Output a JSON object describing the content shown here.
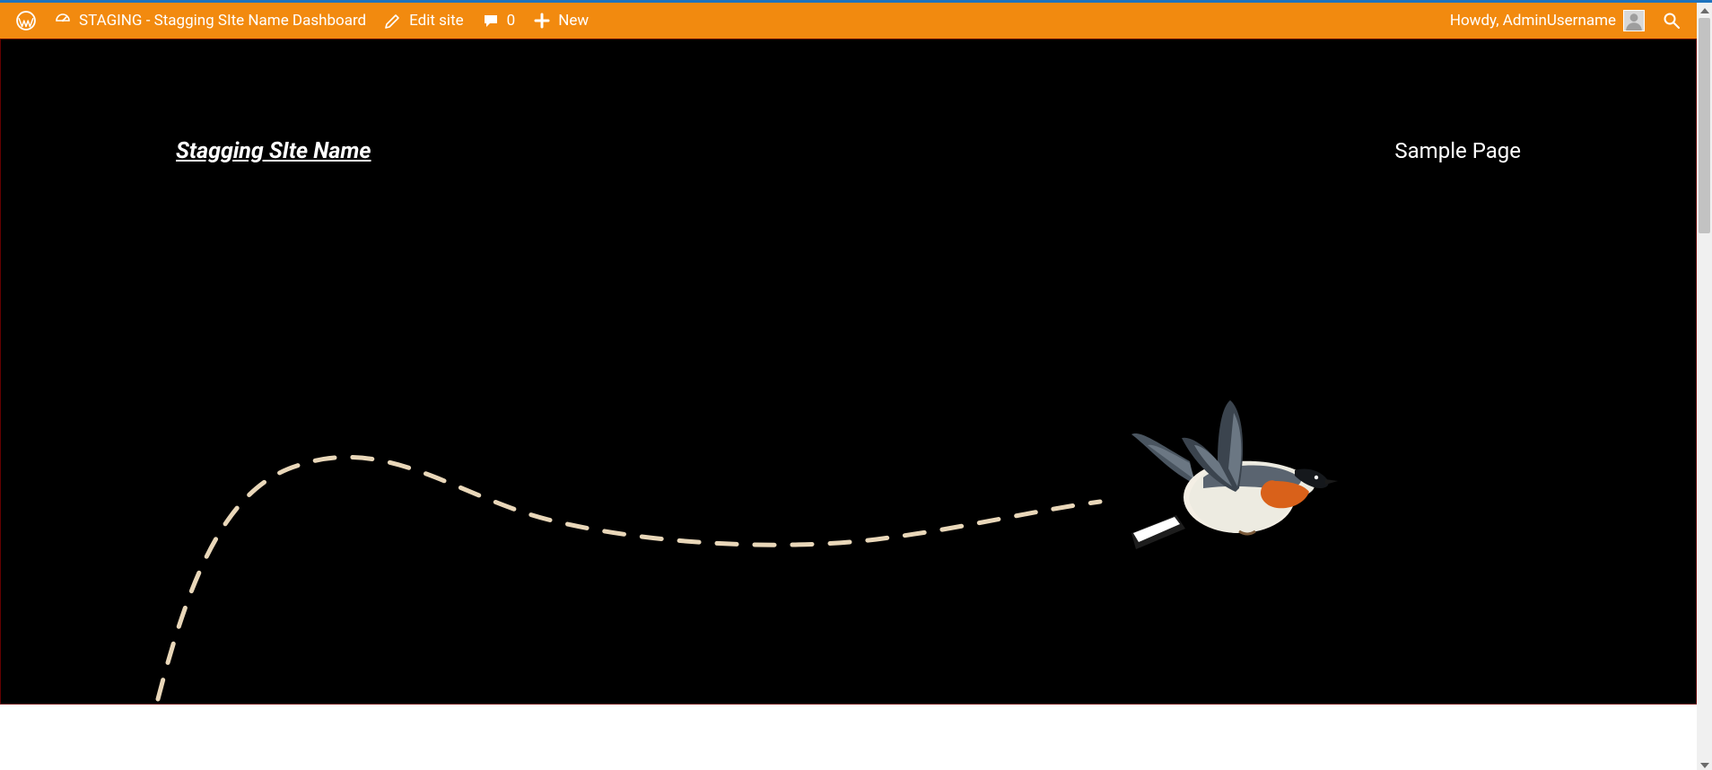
{
  "adminbar": {
    "site_title": "STAGING - Stagging SIte Name Dashboard",
    "edit_site": "Edit site",
    "comments_count": "0",
    "new": "New",
    "howdy": "Howdy, AdminUsername"
  },
  "hero": {
    "site_title": "Stagging SIte Name",
    "nav": {
      "sample_page": "Sample Page"
    }
  },
  "colors": {
    "adminbar_bg": "#f28a0f",
    "hero_bg": "#000000"
  }
}
